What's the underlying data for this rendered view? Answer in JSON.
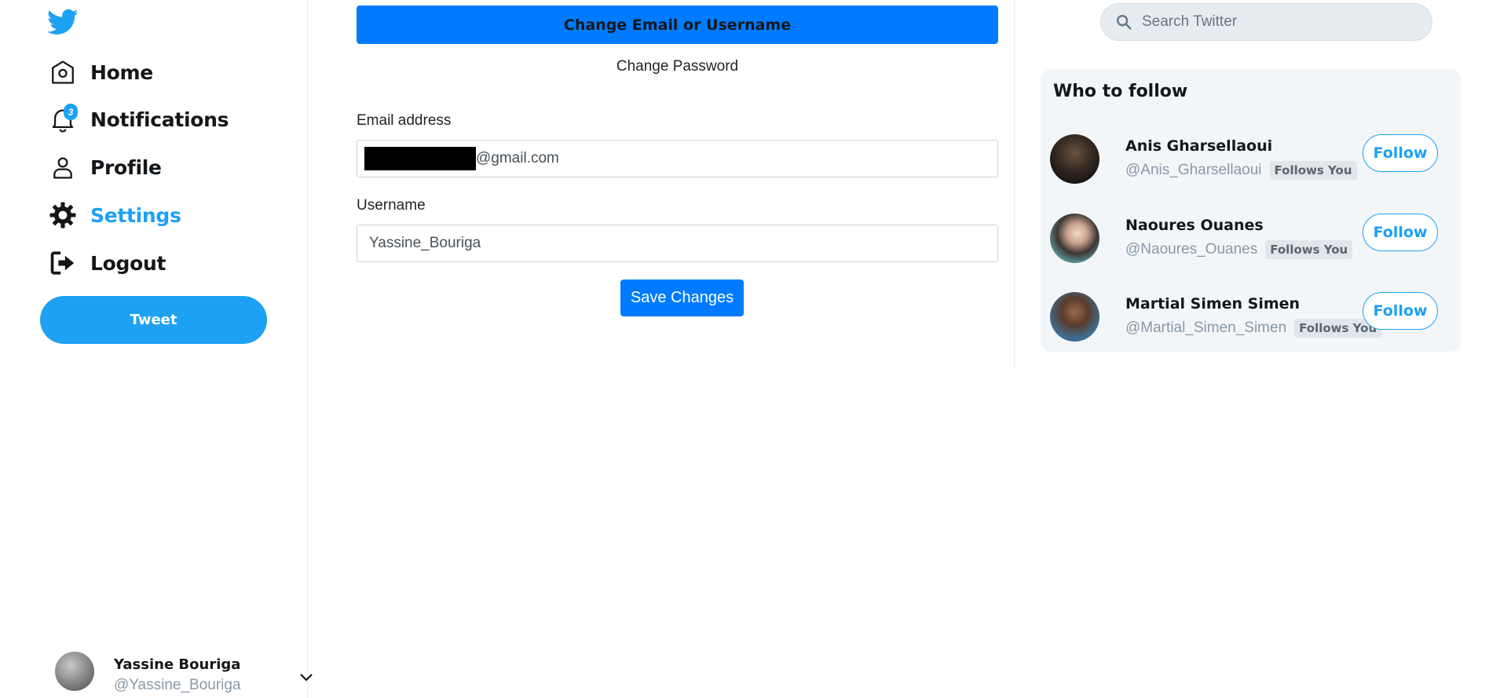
{
  "sidebar": {
    "logo": "twitter-bird-icon",
    "items": [
      {
        "label": "Home",
        "icon": "home-icon"
      },
      {
        "label": "Notifications",
        "icon": "bell-icon",
        "badge": "3"
      },
      {
        "label": "Profile",
        "icon": "person-icon"
      },
      {
        "label": "Settings",
        "icon": "gear-icon",
        "active": true
      },
      {
        "label": "Logout",
        "icon": "logout-icon"
      }
    ],
    "tweet_label": "Tweet",
    "account": {
      "name": "Yassine Bouriga",
      "handle": "@Yassine_Bouriga"
    }
  },
  "main": {
    "change_email_label": "Change Email or Username",
    "change_password_label": "Change Password",
    "email": {
      "label": "Email address",
      "value_suffix": "@gmail.com"
    },
    "username": {
      "label": "Username",
      "value": "Yassine_Bouriga"
    },
    "save_label": "Save Changes"
  },
  "search": {
    "placeholder": "Search Twitter"
  },
  "who_to_follow": {
    "title": "Who to follow",
    "users": [
      {
        "name": "Anis Gharsellaoui",
        "handle": "@Anis_Gharsellaoui",
        "badge": "Follows You",
        "follow_label": "Follow"
      },
      {
        "name": "Naoures Ouanes",
        "handle": "@Naoures_Ouanes",
        "badge": "Follows You",
        "follow_label": "Follow"
      },
      {
        "name": "Martial Simen Simen",
        "handle": "@Martial_Simen_Simen",
        "badge": "Follows You",
        "follow_label": "Follow"
      }
    ]
  },
  "colors": {
    "brand": "#1da1f2",
    "primary_button": "#007bff",
    "panel": "#f3f6f9",
    "muted_text": "#8899a6"
  }
}
